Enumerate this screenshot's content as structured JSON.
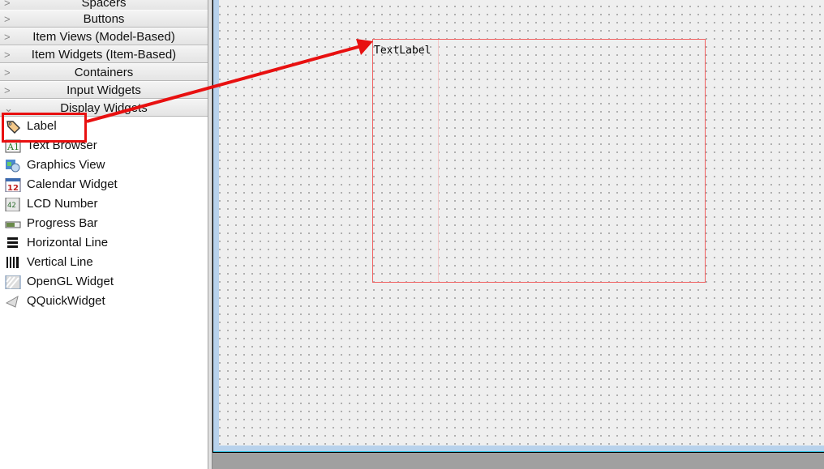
{
  "sidebar": {
    "categories": [
      {
        "label": "Spacers",
        "expanded": false
      },
      {
        "label": "Buttons",
        "expanded": false
      },
      {
        "label": "Item Views (Model-Based)",
        "expanded": false
      },
      {
        "label": "Item Widgets (Item-Based)",
        "expanded": false
      },
      {
        "label": "Containers",
        "expanded": false
      },
      {
        "label": "Input Widgets",
        "expanded": false
      },
      {
        "label": "Display Widgets",
        "expanded": true
      }
    ],
    "items": [
      {
        "label": "Label",
        "icon": "label-tag-icon"
      },
      {
        "label": "Text Browser",
        "icon": "text-browser-icon"
      },
      {
        "label": "Graphics View",
        "icon": "graphics-view-icon"
      },
      {
        "label": "Calendar Widget",
        "icon": "calendar-icon"
      },
      {
        "label": "LCD Number",
        "icon": "lcd-number-icon"
      },
      {
        "label": "Progress Bar",
        "icon": "progress-bar-icon"
      },
      {
        "label": "Horizontal Line",
        "icon": "horizontal-line-icon"
      },
      {
        "label": "Vertical Line",
        "icon": "vertical-line-icon"
      },
      {
        "label": "OpenGL Widget",
        "icon": "opengl-icon"
      },
      {
        "label": "QQuickWidget",
        "icon": "qquick-icon"
      }
    ]
  },
  "form": {
    "label_text": "TextLabel"
  },
  "annotation": {
    "color": "#e81010"
  }
}
